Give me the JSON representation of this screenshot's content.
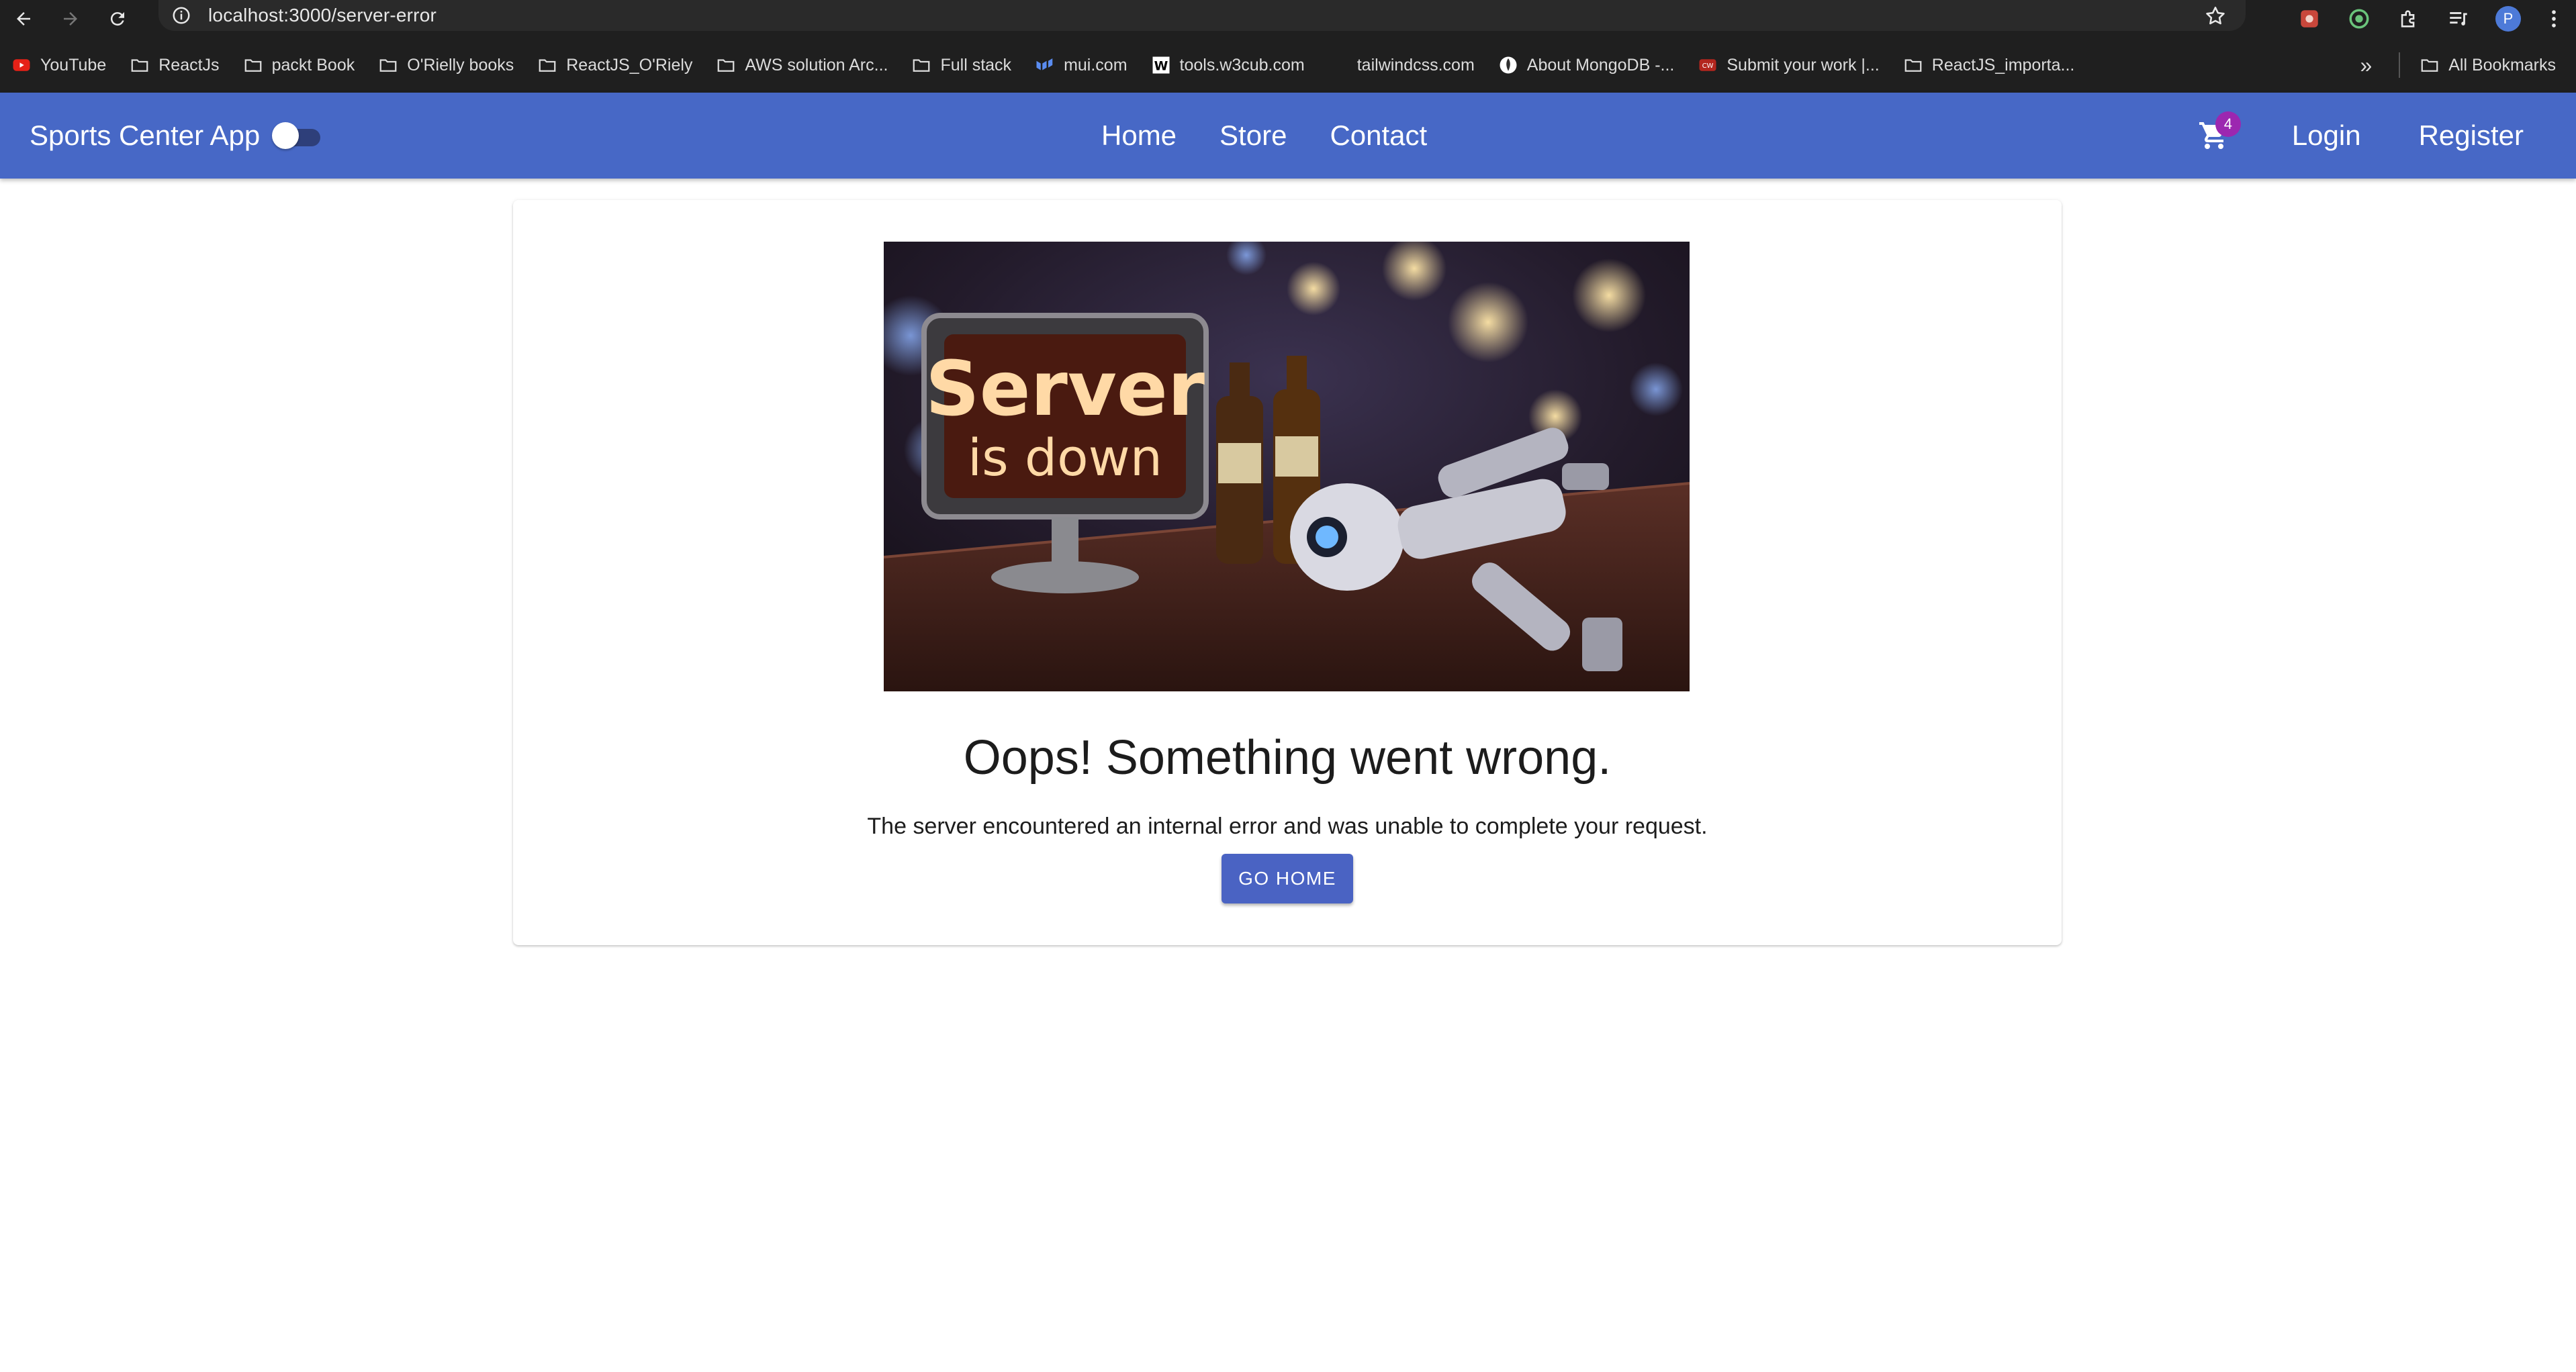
{
  "browser": {
    "url": "localhost:3000/server-error",
    "bookmarks": [
      {
        "label": "YouTube",
        "icon": "youtube-icon"
      },
      {
        "label": "ReactJs",
        "icon": "folder-icon"
      },
      {
        "label": "packt Book",
        "icon": "folder-icon"
      },
      {
        "label": "O'Rielly books",
        "icon": "folder-icon"
      },
      {
        "label": "ReactJS_O'Riely",
        "icon": "folder-icon"
      },
      {
        "label": "AWS solution Arc...",
        "icon": "folder-icon"
      },
      {
        "label": "Full stack",
        "icon": "folder-icon"
      },
      {
        "label": "mui.com",
        "icon": "mui-icon"
      },
      {
        "label": "tools.w3cub.com",
        "icon": "w3cub-icon"
      },
      {
        "label": "tailwindcss.com",
        "icon": "tailwind-icon"
      },
      {
        "label": "About MongoDB -...",
        "icon": "mongodb-icon"
      },
      {
        "label": "Submit your work |...",
        "icon": "submit-icon"
      },
      {
        "label": "ReactJS_importa...",
        "icon": "folder-icon"
      }
    ],
    "all_bookmarks": "All Bookmarks",
    "profile_initial": "P"
  },
  "app": {
    "title": "Sports Center App",
    "nav": [
      "Home",
      "Store",
      "Contact"
    ],
    "cart_count": "4",
    "login": "Login",
    "register": "Register",
    "colors": {
      "primary": "#4768c6",
      "badge": "#9c27b0"
    }
  },
  "error_page": {
    "image_sign_line1": "Server",
    "image_sign_line2": "is down",
    "heading": "Oops! Something went wrong.",
    "message": "The server encountered an internal error and was unable to complete your request.",
    "button": "GO HOME"
  }
}
